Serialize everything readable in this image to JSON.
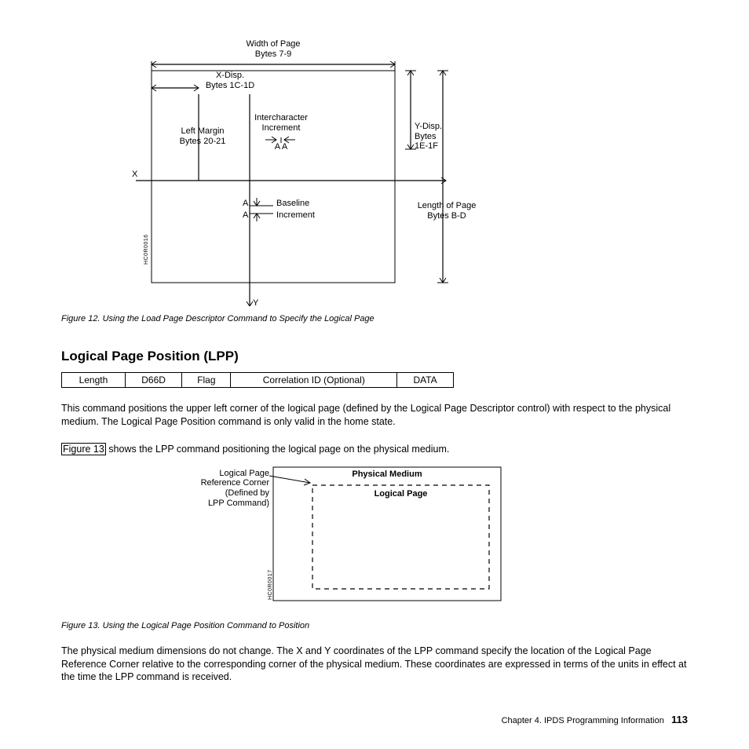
{
  "figure12": {
    "width_of_page": "Width of Page",
    "bytes_7_9": "Bytes 7-9",
    "x_disp": "X-Disp.",
    "bytes_1c_1d": "Bytes 1C-1D",
    "intercharacter": "Intercharacter",
    "increment": "Increment",
    "aa": "A A",
    "left_margin": "Left Margin",
    "bytes_20_21": "Bytes 20-21",
    "y_disp": "Y-Disp.",
    "bytes2": "Bytes",
    "ydisp_bytes": "1E-1F",
    "x_label": "X",
    "a1": "A",
    "a2": "A",
    "baseline": "Baseline",
    "increment2": "Increment",
    "length_of_page": "Length of Page",
    "bytes_b_d": "Bytes B-D",
    "y_label": "Y",
    "sidecode": "HC0R0016",
    "caption": "Figure 12. Using the Load Page Descriptor Command to Specify the Logical Page"
  },
  "heading": "Logical Page Position (LPP)",
  "table": {
    "c1": "Length",
    "c2": "D66D",
    "c3": "Flag",
    "c4": "Correlation ID (Optional)",
    "c5": "DATA"
  },
  "para1": "This command positions the upper left corner of the logical page (defined by the Logical Page Descriptor control) with respect to the physical medium. The Logical Page Position command is only valid in the home state.",
  "para2a": "Figure 13",
  "para2b": " shows the LPP command positioning the logical page on the physical medium.",
  "figure13": {
    "lp1": "Logical Page",
    "lp2": "Reference Corner",
    "lp3": "(Defined by",
    "lp4": "LPP Command)",
    "physical_medium": "Physical Medium",
    "logical_page": "Logical Page",
    "sidecode": "HC0R0017",
    "caption": "Figure 13. Using the Logical Page Position Command to Position"
  },
  "para3": "The physical medium dimensions do not change. The X and Y coordinates of the LPP command specify the location of the Logical Page Reference Corner relative to the corresponding corner of the physical medium. These coordinates are expressed in terms of the units in effect at the time the LPP command is received.",
  "footer": {
    "chapter": "Chapter 4. IPDS Programming Information",
    "page": "113"
  }
}
